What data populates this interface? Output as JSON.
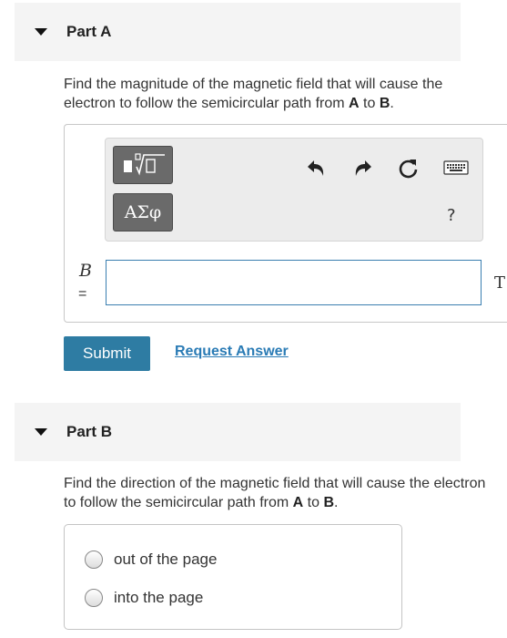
{
  "partA": {
    "title": "Part A",
    "question_pre": "Find the magnitude of the magnetic field that will cause the electron to follow the semicircular path from ",
    "point_a": "A",
    "question_mid": " to ",
    "point_b": "B",
    "question_post": ".",
    "toolbar": {
      "greek_label": "ΑΣφ",
      "help_label": "?",
      "icons": [
        "templates-icon",
        "undo-icon",
        "redo-icon",
        "reset-icon",
        "keyboard-icon"
      ]
    },
    "variable": "B",
    "equals": "=",
    "answer_value": "",
    "unit": "T",
    "submit_label": "Submit",
    "request_label": "Request Answer"
  },
  "partB": {
    "title": "Part B",
    "question_pre": "Find the direction of the magnetic field that will cause the electron to follow the semicircular path from ",
    "point_a": "A",
    "question_mid": " to ",
    "point_b": "B",
    "question_post": ".",
    "options": [
      "out of the page",
      "into the page"
    ],
    "selected": null
  },
  "colors": {
    "accent": "#2e7ca3",
    "link": "#2a7bb5",
    "header_bg": "#f4f4f4",
    "toolbar_button": "#6a6a6a"
  }
}
